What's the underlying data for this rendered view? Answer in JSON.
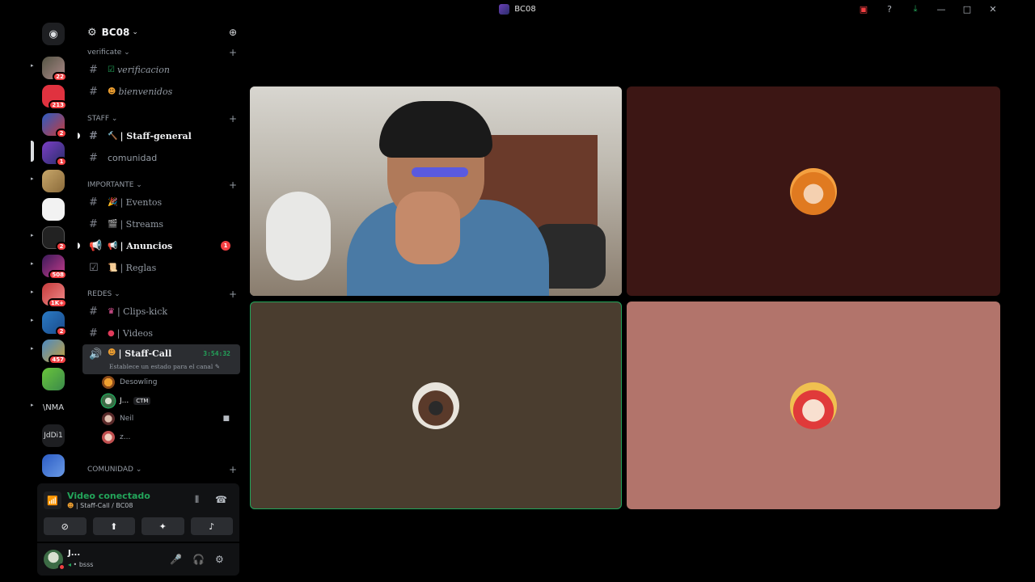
{
  "window": {
    "title": "BC08"
  },
  "rail": {
    "badges": [
      "22",
      "213",
      "2",
      "1",
      "2",
      "508",
      "1K+",
      "2",
      "457"
    ],
    "text_items": [
      "\\NMA",
      "JdDi1"
    ]
  },
  "server": {
    "name": "BC08"
  },
  "categories": {
    "verificate": "verificate",
    "staff": "STAFF",
    "importante": "IMPORTANTE",
    "redes": "REDES",
    "comunidad": "COMUNIDAD"
  },
  "channels": {
    "verificacion": "verificacion",
    "bienvenidos": "bienvenidos",
    "staff_general": "| Staff-general",
    "comunidad": "comunidad",
    "eventos": "| Eventos",
    "streams": "| Streams",
    "anuncios": "| Anuncios",
    "anuncios_mentions": "1",
    "reglas": "| Reglas",
    "clips_kick": "| Clips-kick",
    "videos": "| Videos",
    "staff_call": "| Staff-Call",
    "staff_call_timer": "3:54:32",
    "staff_call_status": "Establece un estado para el canal"
  },
  "voice_users": [
    {
      "name": "Desowling",
      "tag": ""
    },
    {
      "name": "J...",
      "tag": "CTM"
    },
    {
      "name": "Neil",
      "tag": ""
    },
    {
      "name": "z...",
      "tag": ""
    }
  ],
  "voice_panel": {
    "title": "Video conectado",
    "subtitle": "| Staff-Call / BC08"
  },
  "user_panel": {
    "name": "J...",
    "status": "bsss"
  },
  "colors": {
    "tile_top_right": "#3c1614",
    "tile_bottom_left": "#4a3d2f",
    "tile_bottom_right": "#b2746b",
    "speaking": "#23a55a"
  }
}
